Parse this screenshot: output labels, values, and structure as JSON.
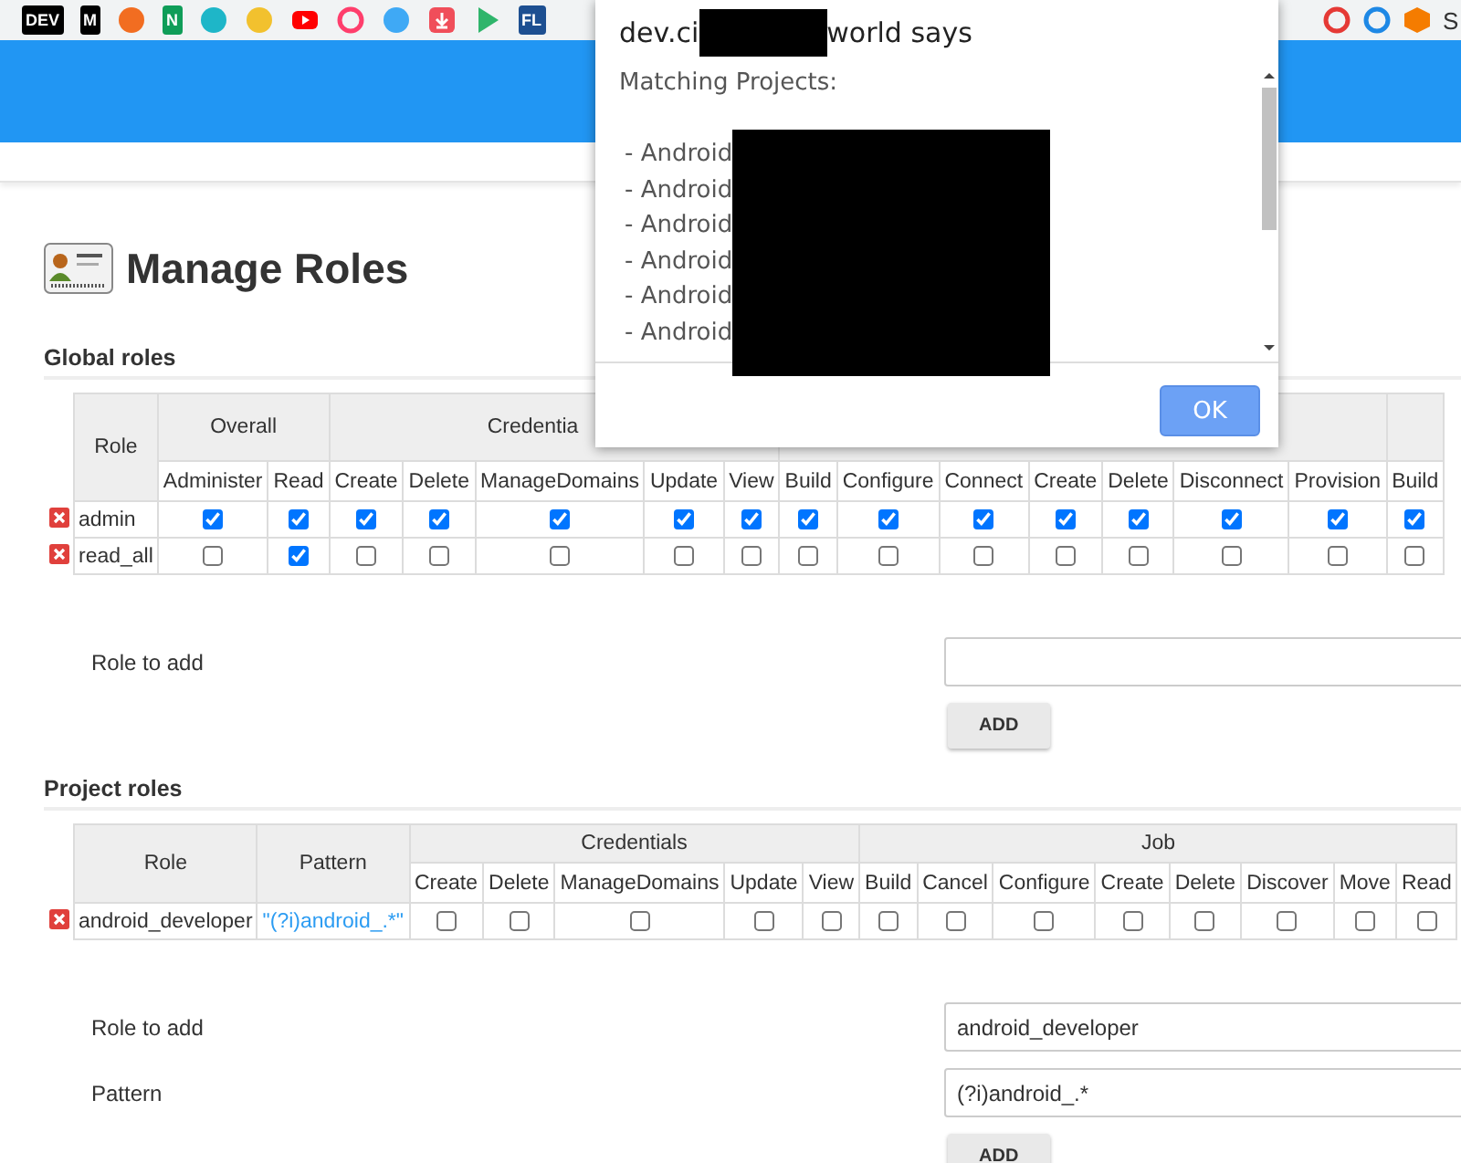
{
  "browser_toolbar": {
    "bookmarks": [
      {
        "kind": "text",
        "label": "DEV",
        "color": "#000000"
      },
      {
        "kind": "text",
        "label": "M",
        "color": "#000000"
      },
      {
        "kind": "circle",
        "color": "#f26d21"
      },
      {
        "kind": "text",
        "label": "N",
        "color": "#0f9d58"
      },
      {
        "kind": "circle",
        "color": "#1eb6c8"
      },
      {
        "kind": "circle",
        "color": "#f2c12e"
      },
      {
        "kind": "play",
        "color": "#ff0000"
      },
      {
        "kind": "ring",
        "color": "#ff3e6c"
      },
      {
        "kind": "circle",
        "color": "#3fa9f5"
      },
      {
        "kind": "square",
        "color": "#f04e5a"
      },
      {
        "kind": "triangle",
        "color": "#2fb56b"
      },
      {
        "kind": "text",
        "label": "FL",
        "color": "#1d4f91"
      }
    ],
    "extensions": [
      {
        "kind": "ring",
        "color": "#e53935"
      },
      {
        "kind": "ring",
        "color": "#1e88e5"
      },
      {
        "kind": "cube",
        "color": "#f57c00"
      },
      {
        "kind": "letter",
        "label": "S",
        "color": "#333333"
      }
    ]
  },
  "page_title": "Manage Roles",
  "global_roles": {
    "heading": "Global roles",
    "role_column": "Role",
    "groups": [
      {
        "label": "Overall",
        "columns": [
          "Administer",
          "Read"
        ]
      },
      {
        "label": "Credentia",
        "columns": [
          "Create",
          "Delete",
          "ManageDomains",
          "Update",
          "View"
        ]
      },
      {
        "columns": [
          "Build",
          "Configure",
          "Connect",
          "Create",
          "Delete",
          "Disconnect",
          "Provision"
        ]
      },
      {
        "columns": [
          "Build"
        ]
      }
    ],
    "rows": [
      {
        "role": "admin",
        "checks": [
          true,
          true,
          true,
          true,
          true,
          true,
          true,
          true,
          true,
          true,
          true,
          true,
          true,
          true,
          true
        ]
      },
      {
        "role": "read_all",
        "checks": [
          false,
          true,
          false,
          false,
          false,
          false,
          false,
          false,
          false,
          false,
          false,
          false,
          false,
          false,
          false
        ]
      }
    ],
    "add_form": {
      "fields": [
        {
          "label": "Role to add"
        }
      ],
      "button": "ADD"
    }
  },
  "project_roles": {
    "heading": "Project roles",
    "role_column": "Role",
    "pattern_column": "Pattern",
    "groups": [
      {
        "label": "Credentials",
        "columns": [
          "Create",
          "Delete",
          "ManageDomains",
          "Update",
          "View"
        ]
      },
      {
        "label": "Job",
        "columns": [
          "Build",
          "Cancel",
          "Configure",
          "Create",
          "Delete",
          "Discover",
          "Move",
          "Read"
        ]
      }
    ],
    "rows": [
      {
        "role": "android_developer",
        "pattern": "\"(?i)android_.*\"",
        "checks": [
          false,
          false,
          false,
          false,
          false,
          false,
          false,
          false,
          false,
          false,
          false,
          false,
          false
        ]
      }
    ],
    "add_form": {
      "fields": [
        {
          "label": "Role to add",
          "value": "android_developer"
        },
        {
          "label": "Pattern",
          "value": "(?i)android_.*"
        }
      ],
      "button": "ADD"
    }
  },
  "dialog": {
    "title_start": "dev.ci",
    "title_end": "world says",
    "message": "Matching Projects:",
    "items": [
      "- Android",
      "- Android",
      "- Android",
      "- Android",
      "- Android",
      "- Android"
    ],
    "button": "OK"
  }
}
